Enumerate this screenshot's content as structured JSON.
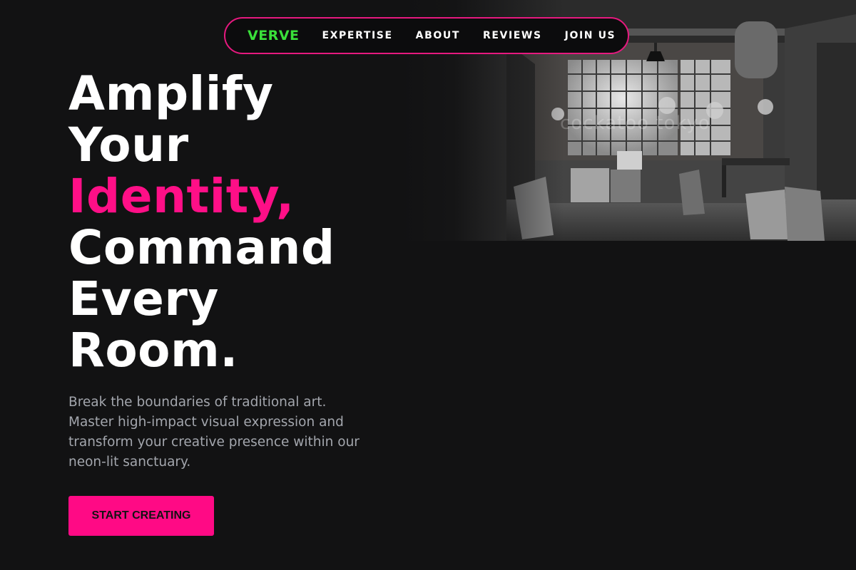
{
  "nav": {
    "logo": "VERVE",
    "links": [
      {
        "label": "EXPERTISE"
      },
      {
        "label": "ABOUT"
      },
      {
        "label": "REVIEWS"
      },
      {
        "label": "JOIN US"
      }
    ]
  },
  "hero": {
    "headline_lines": [
      "Amplify",
      "Your",
      "Identity,",
      "Command",
      "Every",
      "Room."
    ],
    "description": "Break the boundaries of traditional art. Master high-impact visual expression and transform your creative presence within our neon-lit sanctuary.",
    "cta_label": "START CREATING",
    "photo_watermark": "cockatoo tokyo"
  },
  "colors": {
    "background": "#121213",
    "accent_pink": "#ff0f87",
    "logo_green": "#3ae03a",
    "nav_border": "#e6197f",
    "body_text": "#a3a6ad"
  }
}
